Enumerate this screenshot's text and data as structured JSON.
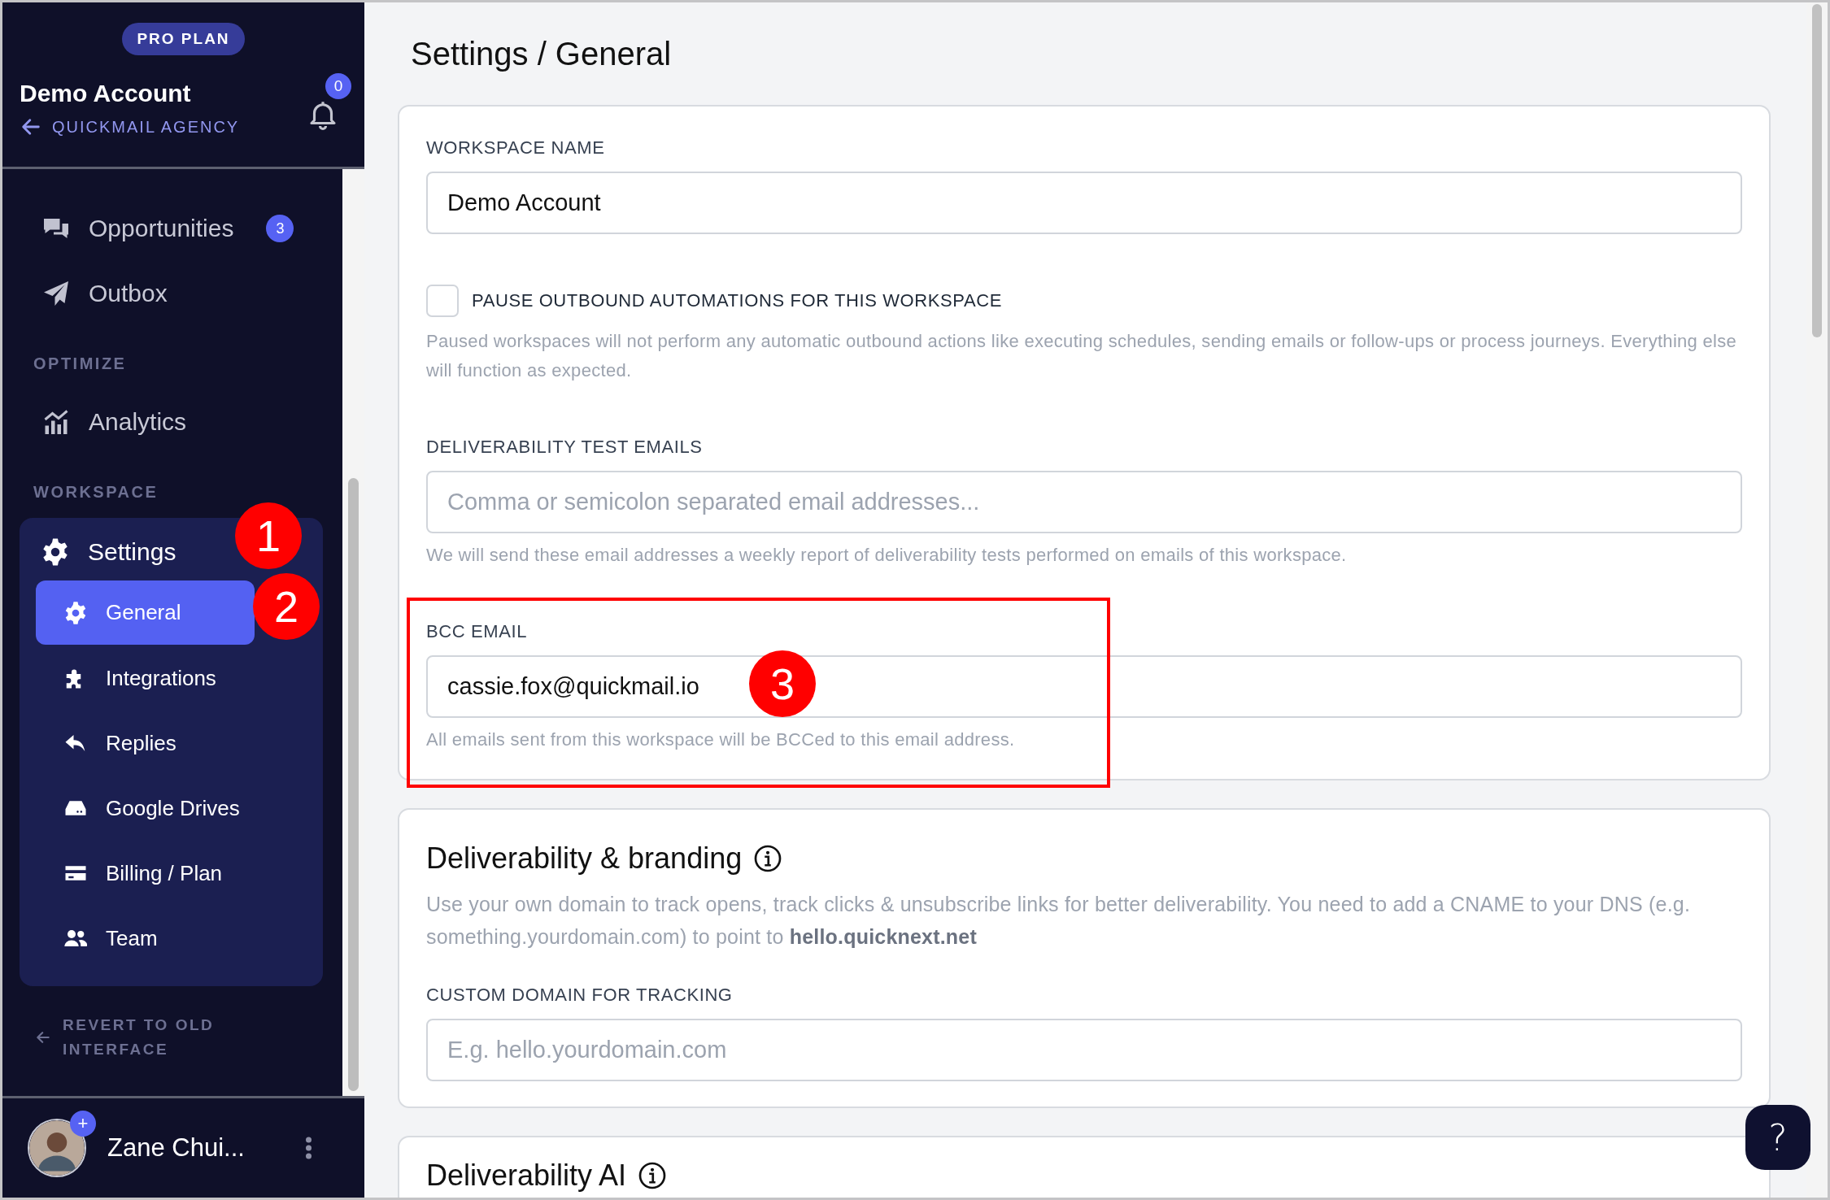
{
  "sidebar": {
    "plan_badge": "PRO PLAN",
    "account_name": "Demo Account",
    "agency_link": "QUICKMAIL AGENCY",
    "notification_count": "0",
    "nav": [
      {
        "kind": "item",
        "label": "Opportunities",
        "badge": "3"
      },
      {
        "kind": "item",
        "label": "Outbox"
      },
      {
        "kind": "heading",
        "label": "OPTIMIZE"
      },
      {
        "kind": "item",
        "label": "Analytics"
      },
      {
        "kind": "heading",
        "label": "WORKSPACE"
      },
      {
        "kind": "group",
        "label": "Settings",
        "children": [
          {
            "label": "General",
            "selected": true
          },
          {
            "label": "Integrations",
            "selected": false
          },
          {
            "label": "Replies",
            "selected": false
          },
          {
            "label": "Google Drives",
            "selected": false
          },
          {
            "label": "Billing / Plan",
            "selected": false
          },
          {
            "label": "Team",
            "selected": false
          }
        ]
      }
    ],
    "revert_link": "REVERT TO OLD INTERFACE",
    "user": {
      "name": "Zane Chui...",
      "avatar_badge": "+"
    }
  },
  "page_title": "Settings / General",
  "general_card": {
    "fields": [
      {
        "kind": "input",
        "label": "WORKSPACE NAME",
        "value": "Demo Account"
      },
      {
        "kind": "checkbox",
        "label": "PAUSE OUTBOUND AUTOMATIONS FOR THIS WORKSPACE",
        "checked": false,
        "help": "Paused workspaces will not perform any automatic outbound actions like executing schedules, sending emails or follow-ups or process journeys. Everything else will function as expected."
      },
      {
        "kind": "input",
        "label": "DELIVERABILITY TEST EMAILS",
        "placeholder": "Comma or semicolon separated email addresses...",
        "help": "We will send these email addresses a weekly report of deliverability tests performed on emails of this workspace."
      },
      {
        "kind": "input",
        "label": "BCC EMAIL",
        "value": "cassie.fox@quickmail.io",
        "help": "All emails sent from this workspace will be BCCed to this email address."
      }
    ]
  },
  "branding_card": {
    "title": "Deliverability & branding",
    "description": "Use your own domain to track opens, track clicks & unsubscribe links for better deliverability. You need to add a CNAME to your DNS (e.g. something.yourdomain.com) to point to **hello.quicknext.net**",
    "fields": [
      {
        "kind": "input",
        "label": "CUSTOM DOMAIN FOR TRACKING",
        "placeholder": "E.g. hello.yourdomain.com"
      }
    ]
  },
  "ai_card": {
    "title": "Deliverability AI"
  },
  "help_button": "?",
  "annotations": [
    {
      "label": "1"
    },
    {
      "label": "2"
    },
    {
      "label": "3"
    }
  ]
}
